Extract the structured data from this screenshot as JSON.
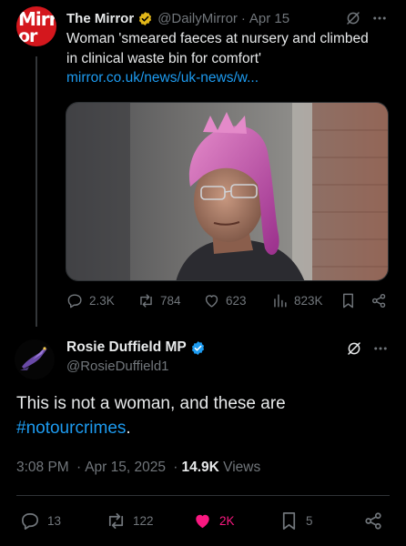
{
  "quoted_tweet": {
    "avatar_text_line1": "Mirr",
    "avatar_text_line2": "or",
    "display_name": "The Mirror",
    "handle": "@DailyMirror",
    "date": "Apr 15",
    "text": "Woman 'smeared faeces at nursery and climbed in clinical waste bin for comfort'",
    "link": "mirror.co.uk/news/uk-news/w...",
    "stats": {
      "replies": "2.3K",
      "reposts": "784",
      "likes": "623",
      "views": "823K"
    }
  },
  "main_tweet": {
    "display_name": "Rosie Duffield MP",
    "handle": "@RosieDuffield1",
    "text_before": "This is not a woman, and these are",
    "hashtag": "#notourcrimes",
    "text_after": ".",
    "time": "3:08 PM",
    "date": "Apr 15, 2025",
    "views_count": "14.9K",
    "views_label": "Views",
    "stats": {
      "replies": "13",
      "reposts": "122",
      "likes": "2K",
      "bookmarks": "5"
    }
  },
  "icons": [
    "verified-badge-icon",
    "grok-icon",
    "more-icon",
    "reply-icon",
    "repost-icon",
    "like-icon",
    "views-icon",
    "bookmark-icon",
    "share-icon"
  ],
  "colors": {
    "background": "#000000",
    "text": "#e7e9ea",
    "muted": "#71767b",
    "link": "#1d9bf0",
    "liked": "#f91880",
    "verified_gold": "#e2b719",
    "verified_blue": "#1d9bf0",
    "mirror_red": "#d4171d"
  }
}
